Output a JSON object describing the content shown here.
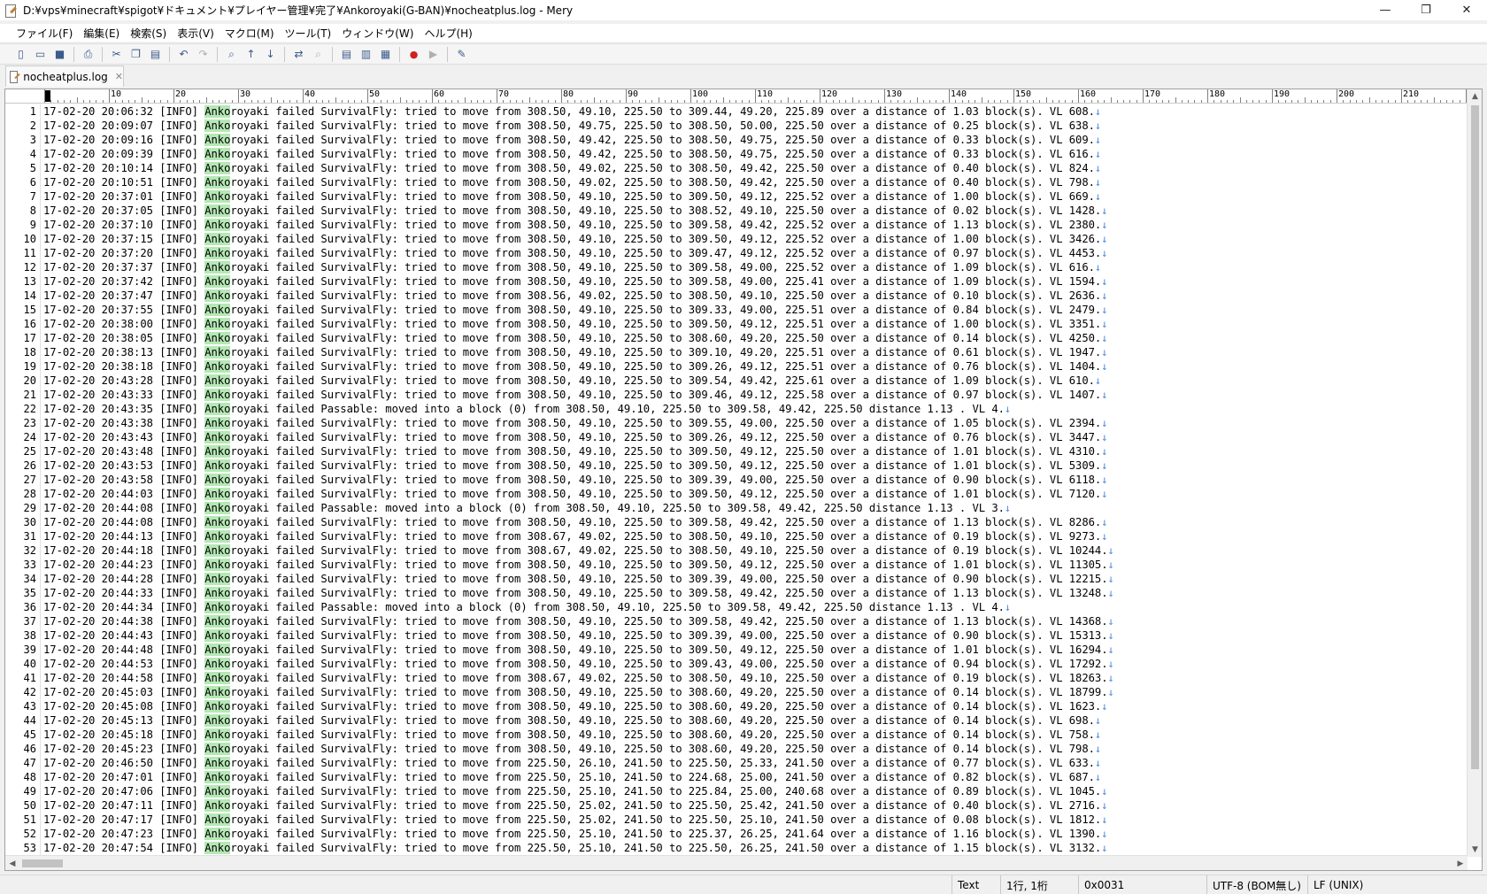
{
  "window": {
    "title": "D:¥vps¥minecraft¥spigot¥ドキュメント¥プレイヤー管理¥完了¥Ankoroyaki(G-BAN)¥nocheatplus.log - Mery",
    "minimize_glyph": "—",
    "maximize_glyph": "❐",
    "close_glyph": "✕"
  },
  "menu": [
    "ファイル(F)",
    "編集(E)",
    "検索(S)",
    "表示(V)",
    "マクロ(M)",
    "ツール(T)",
    "ウィンドウ(W)",
    "ヘルプ(H)"
  ],
  "toolbar": [
    {
      "name": "new-file-icon",
      "glyph": "▯"
    },
    {
      "name": "open-folder-icon",
      "glyph": "▭"
    },
    {
      "name": "save-icon",
      "glyph": "■"
    },
    {
      "sep": true
    },
    {
      "name": "print-icon",
      "glyph": "⎙"
    },
    {
      "sep": true
    },
    {
      "name": "cut-icon",
      "glyph": "✂"
    },
    {
      "name": "copy-icon",
      "glyph": "❐"
    },
    {
      "name": "paste-icon",
      "glyph": "▤"
    },
    {
      "sep": true
    },
    {
      "name": "undo-icon",
      "glyph": "↶"
    },
    {
      "name": "redo-icon",
      "glyph": "↷",
      "disabled": true
    },
    {
      "sep": true
    },
    {
      "name": "find-icon",
      "glyph": "⌕"
    },
    {
      "name": "find-previous-icon",
      "glyph": "↑"
    },
    {
      "name": "find-next-icon",
      "glyph": "↓"
    },
    {
      "sep": true
    },
    {
      "name": "replace-icon",
      "glyph": "⇄"
    },
    {
      "name": "find-in-files-icon",
      "glyph": "⌕",
      "disabled": true
    },
    {
      "sep": true
    },
    {
      "name": "view-single-icon",
      "glyph": "▤"
    },
    {
      "name": "view-split-icon",
      "glyph": "▥"
    },
    {
      "name": "view-columns-icon",
      "glyph": "▦"
    },
    {
      "sep": true
    },
    {
      "name": "macro-record-icon",
      "glyph": "●",
      "red": true
    },
    {
      "name": "macro-play-icon",
      "glyph": "▶",
      "disabled": true
    },
    {
      "sep": true
    },
    {
      "name": "tools-icon",
      "glyph": "✎"
    }
  ],
  "tab": {
    "label": "nocheatplus.log",
    "close_glyph": "✕"
  },
  "ruler": {
    "labels": [
      "0",
      "10",
      "20",
      "30",
      "40",
      "50",
      "60",
      "70",
      "80",
      "90",
      "100",
      "110",
      "120",
      "130",
      "140",
      "150",
      "160",
      "170",
      "180",
      "190",
      "200",
      "210",
      "220"
    ]
  },
  "editor": {
    "highlight_text": "Anko",
    "eol_glyph": "↓",
    "lines": [
      {
        "n": "1",
        "time": "17-02-20 20:06:32",
        "msg": "failed SurvivalFly: tried to move from 308.50, 49.10, 225.50 to 309.44, 49.20, 225.89 over a distance of 1.03 block(s). VL 608."
      },
      {
        "n": "2",
        "time": "17-02-20 20:09:07",
        "msg": "failed SurvivalFly: tried to move from 308.50, 49.75, 225.50 to 308.50, 50.00, 225.50 over a distance of 0.25 block(s). VL 638."
      },
      {
        "n": "3",
        "time": "17-02-20 20:09:16",
        "msg": "failed SurvivalFly: tried to move from 308.50, 49.42, 225.50 to 308.50, 49.75, 225.50 over a distance of 0.33 block(s). VL 609."
      },
      {
        "n": "4",
        "time": "17-02-20 20:09:39",
        "msg": "failed SurvivalFly: tried to move from 308.50, 49.42, 225.50 to 308.50, 49.75, 225.50 over a distance of 0.33 block(s). VL 616."
      },
      {
        "n": "5",
        "time": "17-02-20 20:10:14",
        "msg": "failed SurvivalFly: tried to move from 308.50, 49.02, 225.50 to 308.50, 49.42, 225.50 over a distance of 0.40 block(s). VL 824."
      },
      {
        "n": "6",
        "time": "17-02-20 20:10:51",
        "msg": "failed SurvivalFly: tried to move from 308.50, 49.02, 225.50 to 308.50, 49.42, 225.50 over a distance of 0.40 block(s). VL 798."
      },
      {
        "n": "7",
        "time": "17-02-20 20:37:01",
        "msg": "failed SurvivalFly: tried to move from 308.50, 49.10, 225.50 to 309.50, 49.12, 225.52 over a distance of 1.00 block(s). VL 669."
      },
      {
        "n": "8",
        "time": "17-02-20 20:37:05",
        "msg": "failed SurvivalFly: tried to move from 308.50, 49.10, 225.50 to 308.52, 49.10, 225.50 over a distance of 0.02 block(s). VL 1428."
      },
      {
        "n": "9",
        "time": "17-02-20 20:37:10",
        "msg": "failed SurvivalFly: tried to move from 308.50, 49.10, 225.50 to 309.58, 49.42, 225.52 over a distance of 1.13 block(s). VL 2380."
      },
      {
        "n": "10",
        "time": "17-02-20 20:37:15",
        "msg": "failed SurvivalFly: tried to move from 308.50, 49.10, 225.50 to 309.50, 49.12, 225.52 over a distance of 1.00 block(s). VL 3426."
      },
      {
        "n": "11",
        "time": "17-02-20 20:37:20",
        "msg": "failed SurvivalFly: tried to move from 308.50, 49.10, 225.50 to 309.47, 49.12, 225.52 over a distance of 0.97 block(s). VL 4453."
      },
      {
        "n": "12",
        "time": "17-02-20 20:37:37",
        "msg": "failed SurvivalFly: tried to move from 308.50, 49.10, 225.50 to 309.58, 49.00, 225.52 over a distance of 1.09 block(s). VL 616."
      },
      {
        "n": "13",
        "time": "17-02-20 20:37:42",
        "msg": "failed SurvivalFly: tried to move from 308.50, 49.10, 225.50 to 309.58, 49.00, 225.41 over a distance of 1.09 block(s). VL 1594."
      },
      {
        "n": "14",
        "time": "17-02-20 20:37:47",
        "msg": "failed SurvivalFly: tried to move from 308.56, 49.02, 225.50 to 308.50, 49.10, 225.50 over a distance of 0.10 block(s). VL 2636."
      },
      {
        "n": "15",
        "time": "17-02-20 20:37:55",
        "msg": "failed SurvivalFly: tried to move from 308.50, 49.10, 225.50 to 309.33, 49.00, 225.51 over a distance of 0.84 block(s). VL 2479."
      },
      {
        "n": "16",
        "time": "17-02-20 20:38:00",
        "msg": "failed SurvivalFly: tried to move from 308.50, 49.10, 225.50 to 309.50, 49.12, 225.51 over a distance of 1.00 block(s). VL 3351."
      },
      {
        "n": "17",
        "time": "17-02-20 20:38:05",
        "msg": "failed SurvivalFly: tried to move from 308.50, 49.10, 225.50 to 308.60, 49.20, 225.50 over a distance of 0.14 block(s). VL 4250."
      },
      {
        "n": "18",
        "time": "17-02-20 20:38:13",
        "msg": "failed SurvivalFly: tried to move from 308.50, 49.10, 225.50 to 309.10, 49.20, 225.51 over a distance of 0.61 block(s). VL 1947."
      },
      {
        "n": "19",
        "time": "17-02-20 20:38:18",
        "msg": "failed SurvivalFly: tried to move from 308.50, 49.10, 225.50 to 309.26, 49.12, 225.51 over a distance of 0.76 block(s). VL 1404."
      },
      {
        "n": "20",
        "time": "17-02-20 20:43:28",
        "msg": "failed SurvivalFly: tried to move from 308.50, 49.10, 225.50 to 309.54, 49.42, 225.61 over a distance of 1.09 block(s). VL 610."
      },
      {
        "n": "21",
        "time": "17-02-20 20:43:33",
        "msg": "failed SurvivalFly: tried to move from 308.50, 49.10, 225.50 to 309.46, 49.12, 225.58 over a distance of 0.97 block(s). VL 1407."
      },
      {
        "n": "22",
        "time": "17-02-20 20:43:35",
        "msg": "failed Passable: moved into a block (0) from 308.50, 49.10, 225.50 to 309.58, 49.42, 225.50 distance 1.13 . VL 4."
      },
      {
        "n": "23",
        "time": "17-02-20 20:43:38",
        "msg": "failed SurvivalFly: tried to move from 308.50, 49.10, 225.50 to 309.55, 49.00, 225.50 over a distance of 1.05 block(s). VL 2394."
      },
      {
        "n": "24",
        "time": "17-02-20 20:43:43",
        "msg": "failed SurvivalFly: tried to move from 308.50, 49.10, 225.50 to 309.26, 49.12, 225.50 over a distance of 0.76 block(s). VL 3447."
      },
      {
        "n": "25",
        "time": "17-02-20 20:43:48",
        "msg": "failed SurvivalFly: tried to move from 308.50, 49.10, 225.50 to 309.50, 49.12, 225.50 over a distance of 1.01 block(s). VL 4310."
      },
      {
        "n": "26",
        "time": "17-02-20 20:43:53",
        "msg": "failed SurvivalFly: tried to move from 308.50, 49.10, 225.50 to 309.50, 49.12, 225.50 over a distance of 1.01 block(s). VL 5309."
      },
      {
        "n": "27",
        "time": "17-02-20 20:43:58",
        "msg": "failed SurvivalFly: tried to move from 308.50, 49.10, 225.50 to 309.39, 49.00, 225.50 over a distance of 0.90 block(s). VL 6118."
      },
      {
        "n": "28",
        "time": "17-02-20 20:44:03",
        "msg": "failed SurvivalFly: tried to move from 308.50, 49.10, 225.50 to 309.50, 49.12, 225.50 over a distance of 1.01 block(s). VL 7120."
      },
      {
        "n": "29",
        "time": "17-02-20 20:44:08",
        "msg": "failed Passable: moved into a block (0) from 308.50, 49.10, 225.50 to 309.58, 49.42, 225.50 distance 1.13 . VL 3."
      },
      {
        "n": "30",
        "time": "17-02-20 20:44:08",
        "msg": "failed SurvivalFly: tried to move from 308.50, 49.10, 225.50 to 309.58, 49.42, 225.50 over a distance of 1.13 block(s). VL 8286."
      },
      {
        "n": "31",
        "time": "17-02-20 20:44:13",
        "msg": "failed SurvivalFly: tried to move from 308.67, 49.02, 225.50 to 308.50, 49.10, 225.50 over a distance of 0.19 block(s). VL 9273."
      },
      {
        "n": "32",
        "time": "17-02-20 20:44:18",
        "msg": "failed SurvivalFly: tried to move from 308.67, 49.02, 225.50 to 308.50, 49.10, 225.50 over a distance of 0.19 block(s). VL 10244."
      },
      {
        "n": "33",
        "time": "17-02-20 20:44:23",
        "msg": "failed SurvivalFly: tried to move from 308.50, 49.10, 225.50 to 309.50, 49.12, 225.50 over a distance of 1.01 block(s). VL 11305."
      },
      {
        "n": "34",
        "time": "17-02-20 20:44:28",
        "msg": "failed SurvivalFly: tried to move from 308.50, 49.10, 225.50 to 309.39, 49.00, 225.50 over a distance of 0.90 block(s). VL 12215."
      },
      {
        "n": "35",
        "time": "17-02-20 20:44:33",
        "msg": "failed SurvivalFly: tried to move from 308.50, 49.10, 225.50 to 309.58, 49.42, 225.50 over a distance of 1.13 block(s). VL 13248."
      },
      {
        "n": "36",
        "time": "17-02-20 20:44:34",
        "msg": "failed Passable: moved into a block (0) from 308.50, 49.10, 225.50 to 309.58, 49.42, 225.50 distance 1.13 . VL 4."
      },
      {
        "n": "37",
        "time": "17-02-20 20:44:38",
        "msg": "failed SurvivalFly: tried to move from 308.50, 49.10, 225.50 to 309.58, 49.42, 225.50 over a distance of 1.13 block(s). VL 14368."
      },
      {
        "n": "38",
        "time": "17-02-20 20:44:43",
        "msg": "failed SurvivalFly: tried to move from 308.50, 49.10, 225.50 to 309.39, 49.00, 225.50 over a distance of 0.90 block(s). VL 15313."
      },
      {
        "n": "39",
        "time": "17-02-20 20:44:48",
        "msg": "failed SurvivalFly: tried to move from 308.50, 49.10, 225.50 to 309.50, 49.12, 225.50 over a distance of 1.01 block(s). VL 16294."
      },
      {
        "n": "40",
        "time": "17-02-20 20:44:53",
        "msg": "failed SurvivalFly: tried to move from 308.50, 49.10, 225.50 to 309.43, 49.00, 225.50 over a distance of 0.94 block(s). VL 17292."
      },
      {
        "n": "41",
        "time": "17-02-20 20:44:58",
        "msg": "failed SurvivalFly: tried to move from 308.67, 49.02, 225.50 to 308.50, 49.10, 225.50 over a distance of 0.19 block(s). VL 18263."
      },
      {
        "n": "42",
        "time": "17-02-20 20:45:03",
        "msg": "failed SurvivalFly: tried to move from 308.50, 49.10, 225.50 to 308.60, 49.20, 225.50 over a distance of 0.14 block(s). VL 18799."
      },
      {
        "n": "43",
        "time": "17-02-20 20:45:08",
        "msg": "failed SurvivalFly: tried to move from 308.50, 49.10, 225.50 to 308.60, 49.20, 225.50 over a distance of 0.14 block(s). VL 1623."
      },
      {
        "n": "44",
        "time": "17-02-20 20:45:13",
        "msg": "failed SurvivalFly: tried to move from 308.50, 49.10, 225.50 to 308.60, 49.20, 225.50 over a distance of 0.14 block(s). VL 698."
      },
      {
        "n": "45",
        "time": "17-02-20 20:45:18",
        "msg": "failed SurvivalFly: tried to move from 308.50, 49.10, 225.50 to 308.60, 49.20, 225.50 over a distance of 0.14 block(s). VL 758."
      },
      {
        "n": "46",
        "time": "17-02-20 20:45:23",
        "msg": "failed SurvivalFly: tried to move from 308.50, 49.10, 225.50 to 308.60, 49.20, 225.50 over a distance of 0.14 block(s). VL 798."
      },
      {
        "n": "47",
        "time": "17-02-20 20:46:50",
        "msg": "failed SurvivalFly: tried to move from 225.50, 26.10, 241.50 to 225.50, 25.33, 241.50 over a distance of 0.77 block(s). VL 633."
      },
      {
        "n": "48",
        "time": "17-02-20 20:47:01",
        "msg": "failed SurvivalFly: tried to move from 225.50, 25.10, 241.50 to 224.68, 25.00, 241.50 over a distance of 0.82 block(s). VL 687."
      },
      {
        "n": "49",
        "time": "17-02-20 20:47:06",
        "msg": "failed SurvivalFly: tried to move from 225.50, 25.10, 241.50 to 225.84, 25.00, 240.68 over a distance of 0.89 block(s). VL 1045."
      },
      {
        "n": "50",
        "time": "17-02-20 20:47:11",
        "msg": "failed SurvivalFly: tried to move from 225.50, 25.02, 241.50 to 225.50, 25.42, 241.50 over a distance of 0.40 block(s). VL 2716."
      },
      {
        "n": "51",
        "time": "17-02-20 20:47:17",
        "msg": "failed SurvivalFly: tried to move from 225.50, 25.02, 241.50 to 225.50, 25.10, 241.50 over a distance of 0.08 block(s). VL 1812."
      },
      {
        "n": "52",
        "time": "17-02-20 20:47:23",
        "msg": "failed SurvivalFly: tried to move from 225.50, 25.10, 241.50 to 225.37, 26.25, 241.64 over a distance of 1.16 block(s). VL 1390."
      },
      {
        "n": "53",
        "time": "17-02-20 20:47:54",
        "msg": "failed SurvivalFly: tried to move from 225.50, 25.10, 241.50 to 225.50, 26.25, 241.50 over a distance of 1.15 block(s). VL 3132."
      }
    ]
  },
  "log": {
    "level": "[INFO]",
    "player": "Ankoroyaki"
  },
  "statusbar": {
    "mode": "Text",
    "position": "1行, 1桁",
    "char_code": "0x0031",
    "encoding": "UTF-8 (BOM無し)",
    "line_ending": "LF (UNIX)"
  },
  "colors": {
    "highlight": "#b5e8b5",
    "eol": "#4a8adc"
  }
}
